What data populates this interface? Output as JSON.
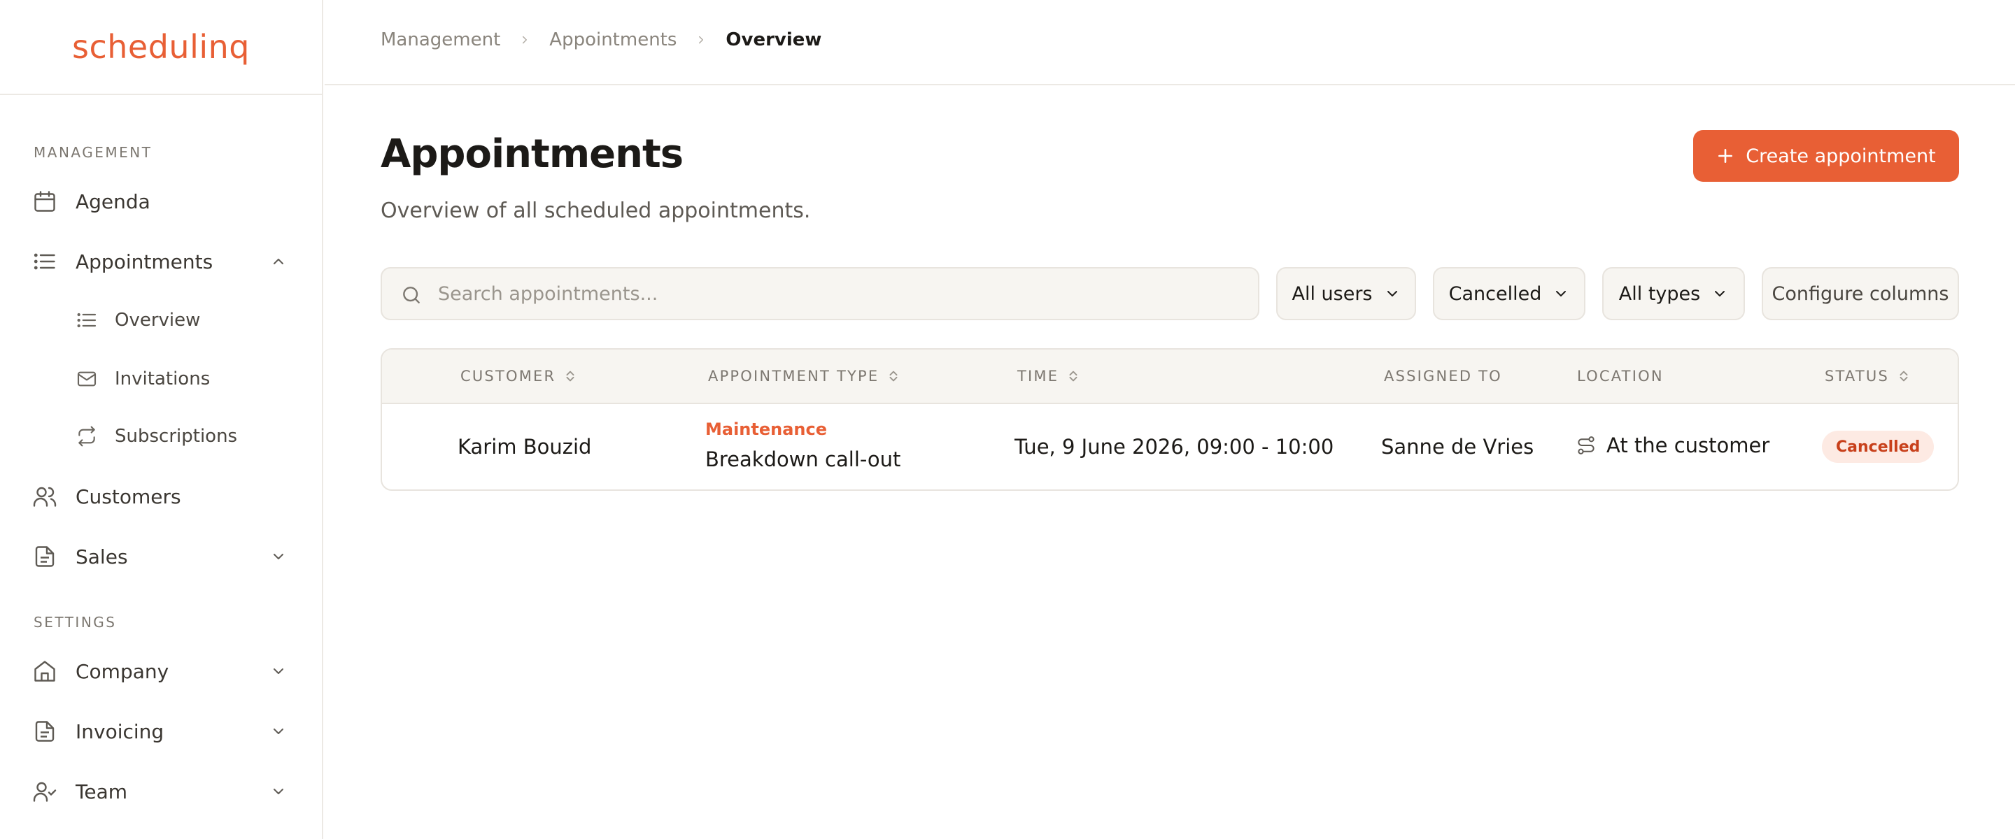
{
  "app": {
    "logo": "schedulinq"
  },
  "sidebar": {
    "sections": {
      "management": "MANAGEMENT",
      "settings": "SETTINGS"
    },
    "items": {
      "agenda": "Agenda",
      "appointments": "Appointments",
      "overview": "Overview",
      "invitations": "Invitations",
      "subscriptions": "Subscriptions",
      "customers": "Customers",
      "sales": "Sales",
      "company": "Company",
      "invoicing": "Invoicing",
      "team": "Team"
    }
  },
  "breadcrumb": [
    "Management",
    "Appointments",
    "Overview"
  ],
  "page": {
    "title": "Appointments",
    "subtitle": "Overview of all scheduled appointments.",
    "create_button": "Create appointment"
  },
  "filters": {
    "search_placeholder": "Search appointments...",
    "users": "All users",
    "status": "Cancelled",
    "types": "All types",
    "configure": "Configure columns"
  },
  "table": {
    "columns": [
      "CUSTOMER",
      "APPOINTMENT TYPE",
      "TIME",
      "ASSIGNED TO",
      "LOCATION",
      "STATUS"
    ],
    "rows": [
      {
        "customer": "Karim Bouzid",
        "type_tag": "Maintenance",
        "type": "Breakdown call-out",
        "time": "Tue, 9 June 2026, 09:00 - 10:00",
        "assigned": "Sanne de Vries",
        "location": "At the customer",
        "status": "Cancelled"
      }
    ]
  },
  "colors": {
    "accent": "#e85f35",
    "status_cancelled_bg": "#fdeae3",
    "status_cancelled_fg": "#c8401b"
  }
}
